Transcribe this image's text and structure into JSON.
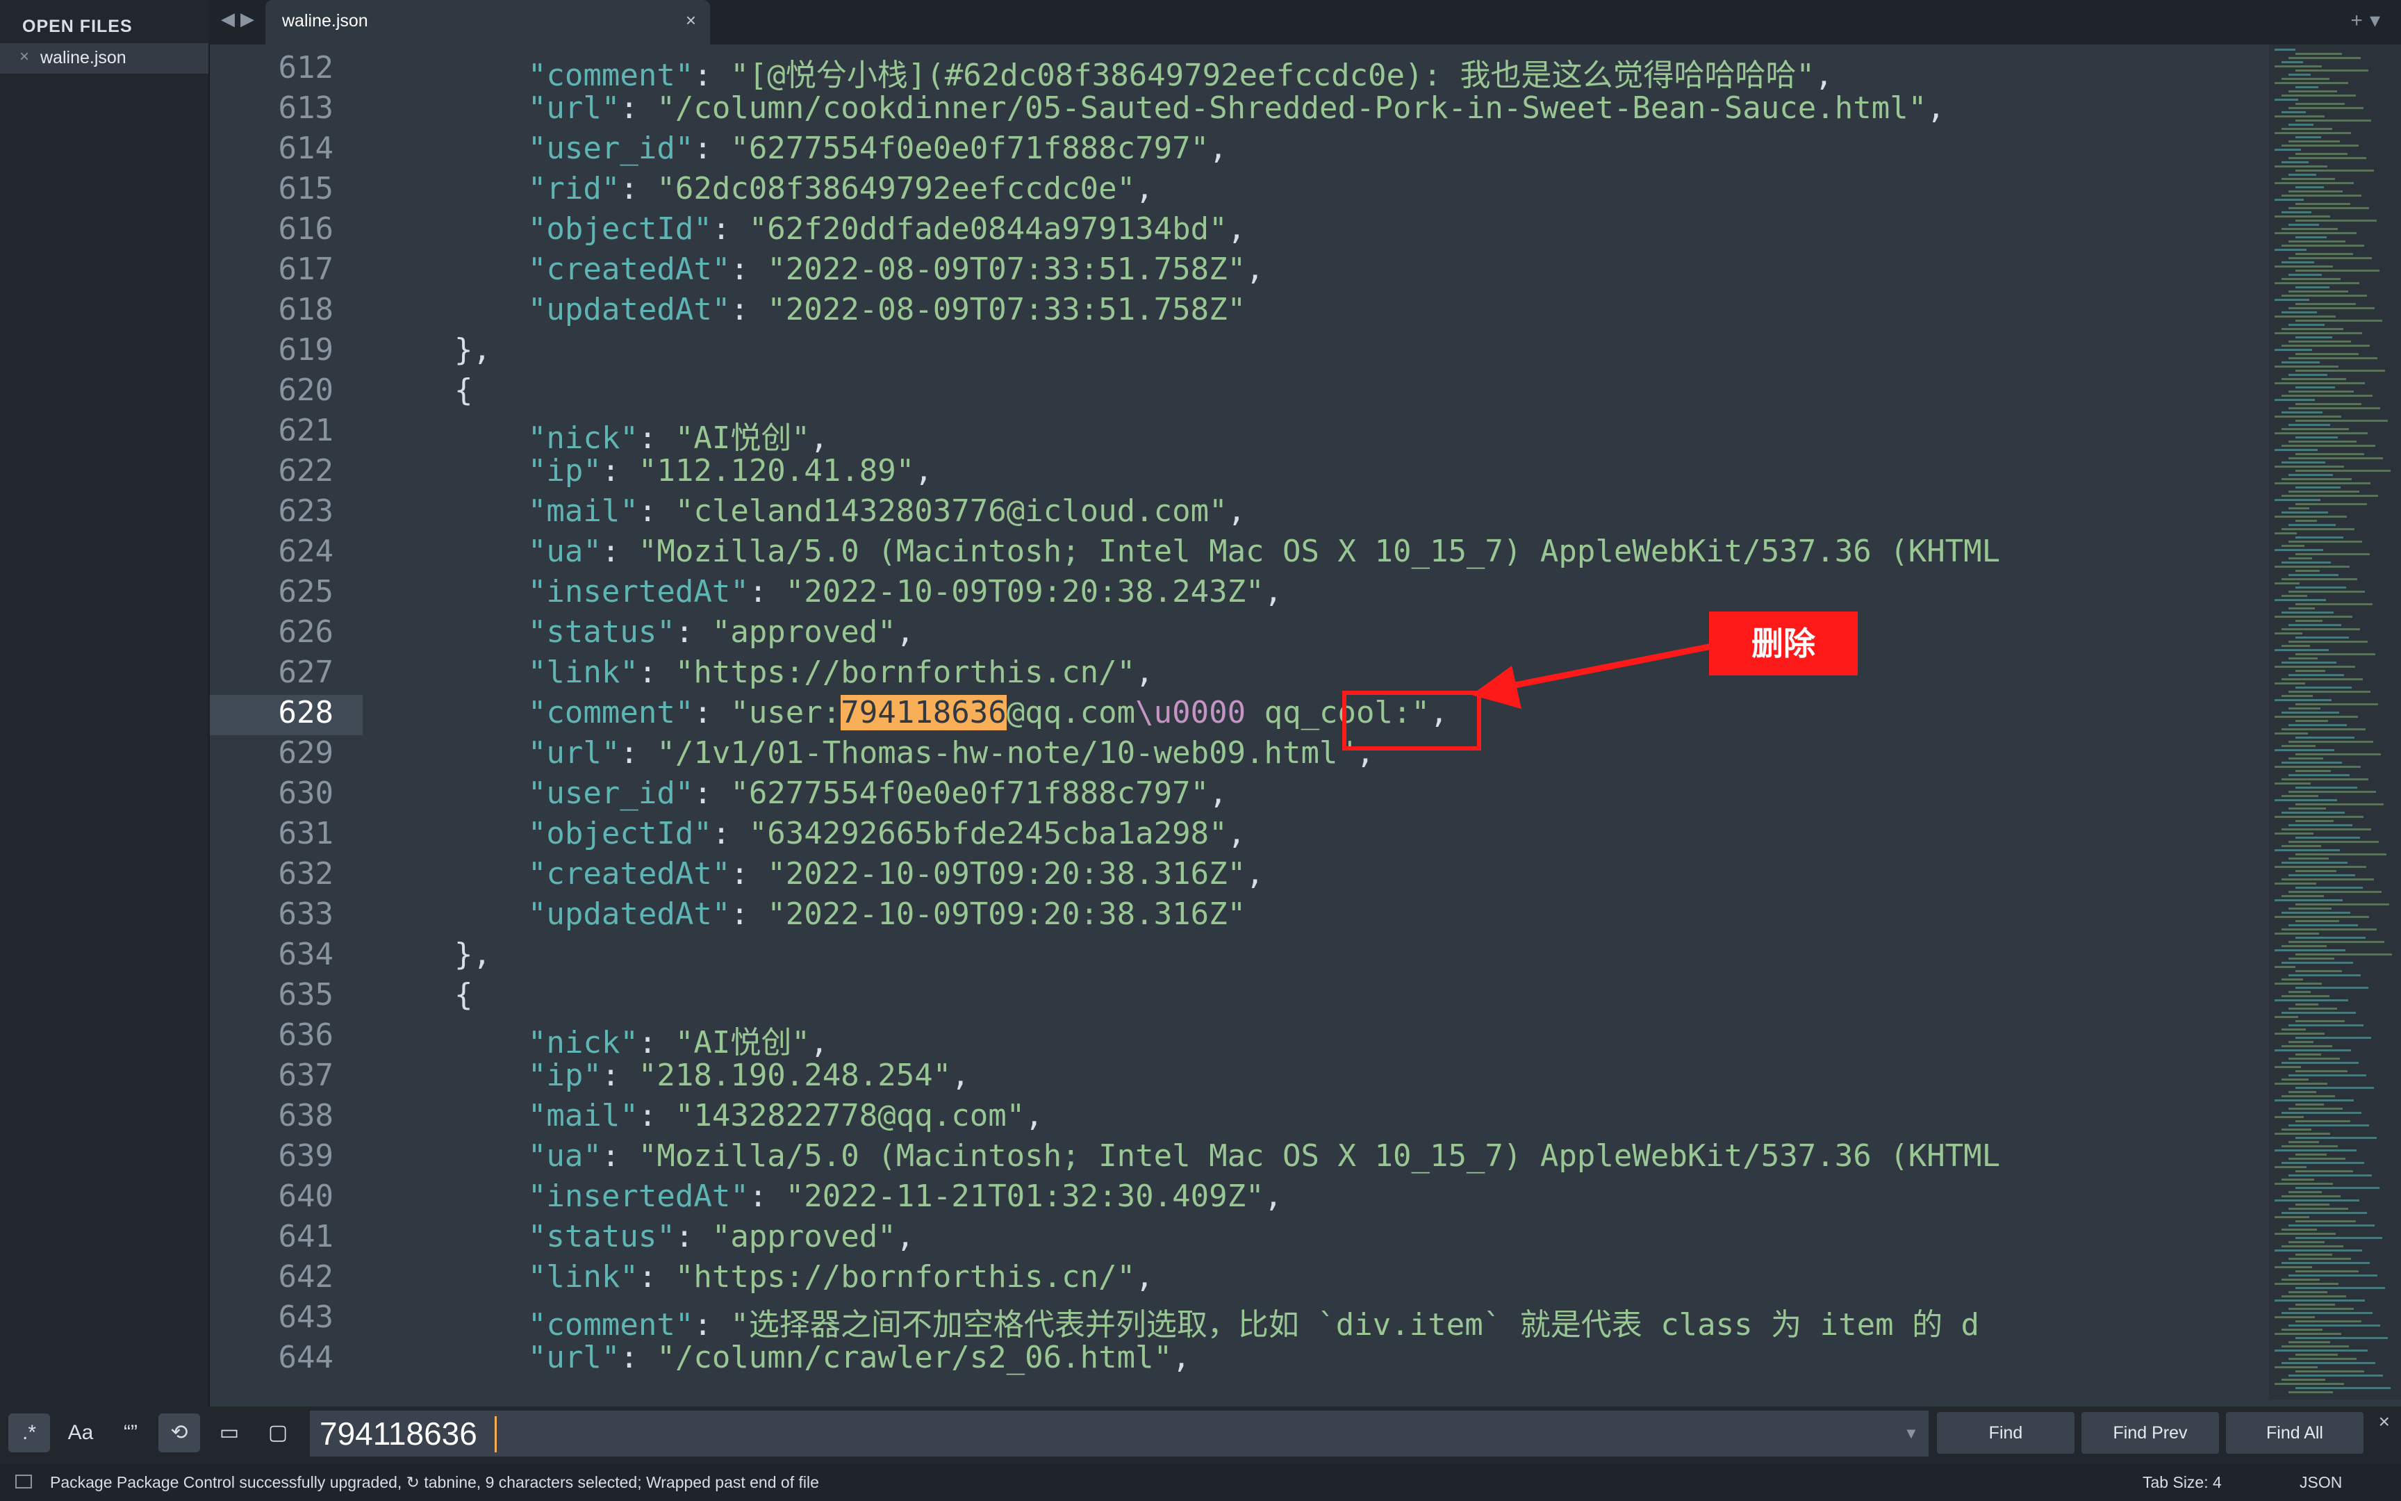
{
  "sidebar": {
    "title": "OPEN FILES",
    "files": [
      {
        "name": "waline.json"
      }
    ]
  },
  "tabs": [
    {
      "label": "waline.json",
      "active": true
    }
  ],
  "editor": {
    "active_line": 628,
    "lines": [
      {
        "n": 612,
        "text": "        \"comment\": \"[@悦兮小栈](#62dc08f38649792eefccdc0e): 我也是这么觉得哈哈哈哈\","
      },
      {
        "n": 613,
        "text": "        \"url\": \"/column/cookdinner/05-Sauted-Shredded-Pork-in-Sweet-Bean-Sauce.html\","
      },
      {
        "n": 614,
        "text": "        \"user_id\": \"6277554f0e0e0f71f888c797\","
      },
      {
        "n": 615,
        "text": "        \"rid\": \"62dc08f38649792eefccdc0e\","
      },
      {
        "n": 616,
        "text": "        \"objectId\": \"62f20ddfade0844a979134bd\","
      },
      {
        "n": 617,
        "text": "        \"createdAt\": \"2022-08-09T07:33:51.758Z\","
      },
      {
        "n": 618,
        "text": "        \"updatedAt\": \"2022-08-09T07:33:51.758Z\""
      },
      {
        "n": 619,
        "text": "    },"
      },
      {
        "n": 620,
        "text": "    {"
      },
      {
        "n": 621,
        "text": "        \"nick\": \"AI悦创\","
      },
      {
        "n": 622,
        "text": "        \"ip\": \"112.120.41.89\","
      },
      {
        "n": 623,
        "text": "        \"mail\": \"cleland1432803776@icloud.com\","
      },
      {
        "n": 624,
        "text": "        \"ua\": \"Mozilla/5.0 (Macintosh; Intel Mac OS X 10_15_7) AppleWebKit/537.36 (KHTML"
      },
      {
        "n": 625,
        "text": "        \"insertedAt\": \"2022-10-09T09:20:38.243Z\","
      },
      {
        "n": 626,
        "text": "        \"status\": \"approved\","
      },
      {
        "n": 627,
        "text": "        \"link\": \"https://bornforthis.cn/\","
      },
      {
        "n": 628,
        "text": "        \"comment\": \"user:794118636@qq.com\\u0000 qq_cool:\","
      },
      {
        "n": 629,
        "text": "        \"url\": \"/1v1/01-Thomas-hw-note/10-web09.html\","
      },
      {
        "n": 630,
        "text": "        \"user_id\": \"6277554f0e0e0f71f888c797\","
      },
      {
        "n": 631,
        "text": "        \"objectId\": \"634292665bfde245cba1a298\","
      },
      {
        "n": 632,
        "text": "        \"createdAt\": \"2022-10-09T09:20:38.316Z\","
      },
      {
        "n": 633,
        "text": "        \"updatedAt\": \"2022-10-09T09:20:38.316Z\""
      },
      {
        "n": 634,
        "text": "    },"
      },
      {
        "n": 635,
        "text": "    {"
      },
      {
        "n": 636,
        "text": "        \"nick\": \"AI悦创\","
      },
      {
        "n": 637,
        "text": "        \"ip\": \"218.190.248.254\","
      },
      {
        "n": 638,
        "text": "        \"mail\": \"1432822778@qq.com\","
      },
      {
        "n": 639,
        "text": "        \"ua\": \"Mozilla/5.0 (Macintosh; Intel Mac OS X 10_15_7) AppleWebKit/537.36 (KHTML"
      },
      {
        "n": 640,
        "text": "        \"insertedAt\": \"2022-11-21T01:32:30.409Z\","
      },
      {
        "n": 641,
        "text": "        \"status\": \"approved\","
      },
      {
        "n": 642,
        "text": "        \"link\": \"https://bornforthis.cn/\","
      },
      {
        "n": 643,
        "text": "        \"comment\": \"选择器之间不加空格代表并列选取，比如 `div.item` 就是代表 class 为 item 的 d"
      },
      {
        "n": 644,
        "text": "        \"url\": \"/column/crawler/s2_06.html\","
      }
    ],
    "highlight": {
      "line": 628,
      "match": "794118636",
      "escape": "\\u0000"
    }
  },
  "annotation": {
    "label": "删除",
    "color": "#ff1a1a"
  },
  "find_bar": {
    "options": [
      {
        "icon": "regex-icon",
        "glyph": ".*",
        "active": true
      },
      {
        "icon": "case-sensitive-icon",
        "glyph": "Aa",
        "active": false
      },
      {
        "icon": "whole-word-icon",
        "glyph": "“”",
        "active": false
      },
      {
        "icon": "wrap-icon",
        "glyph": "⟲",
        "active": true
      },
      {
        "icon": "in-selection-icon",
        "glyph": "▭",
        "active": false
      },
      {
        "icon": "highlight-matches-icon",
        "glyph": "▢",
        "active": false
      }
    ],
    "query": "794118636",
    "buttons": {
      "find": "Find",
      "find_prev": "Find Prev",
      "find_all": "Find All"
    }
  },
  "status_bar": {
    "message": "Package Package Control successfully upgraded, ↻ tabnine, 9 characters selected; Wrapped past end of file",
    "tab_size": "Tab Size: 4",
    "syntax": "JSON"
  },
  "colors": {
    "background": "#303841",
    "sidebar": "#22272e",
    "key": "#5fb4b4",
    "string": "#99c794",
    "match_highlight": "#f9ae58",
    "escape": "#c594c5"
  }
}
